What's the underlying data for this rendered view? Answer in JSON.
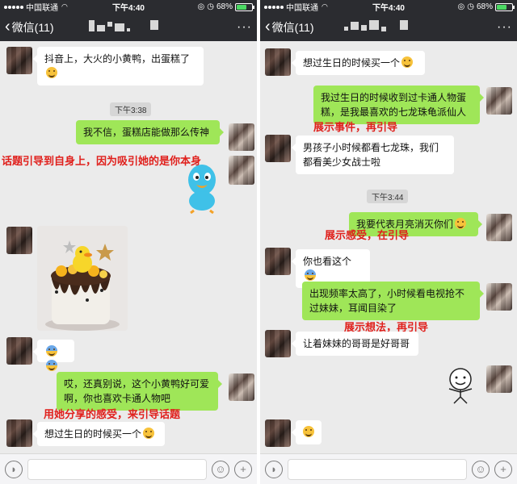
{
  "status_bar": {
    "carrier": "中国联通",
    "time": "下午4:40",
    "battery": "68%",
    "battery_level": 0.68
  },
  "nav": {
    "back_label": "微信(11)",
    "more_label": "···"
  },
  "left_chat": {
    "msg1": "抖音上，大火的小黄鸭，出蛋糕了",
    "time1": "下午3:38",
    "msg2": "我不信，蛋糕店能做那么传神",
    "annot1": "话题引导到自身上，因为吸引她的是你本身",
    "msg3": "哎，还真别说，这个小黄鸭好可爱啊，你也喜欢卡通人物吧",
    "annot2": "用她分享的感受，来引导话题",
    "msg4": "想过生日的时候买一个"
  },
  "right_chat": {
    "msg1": "想过生日的时候买一个",
    "msg2": "我过生日的时候收到过卡通人物蛋糕，是我最喜欢的七龙珠龟派仙人",
    "annot1": "展示事件，再引导",
    "msg3": "男孩子小时候都看七龙珠，我们都看美少女战士啦",
    "time1": "下午3:44",
    "msg4": "我要代表月亮消灭你们",
    "annot2": "展示感受，在引导",
    "msg5": "你也看这个",
    "msg6": "出现频率太高了，小时候看电视抢不过妹妹，耳闻目染了",
    "annot3": "展示想法，再引导",
    "msg7": "让着妹妹的哥哥是好哥哥"
  },
  "colors": {
    "nav_bg": "#2b2c30",
    "chat_bg": "#ebebeb",
    "bubble_out": "#9fe658",
    "bubble_in": "#ffffff",
    "annotation": "#e0201c"
  },
  "icons": [
    "chevron-left-icon",
    "more-icon",
    "voice-icon",
    "emoji-icon",
    "plus-icon"
  ]
}
